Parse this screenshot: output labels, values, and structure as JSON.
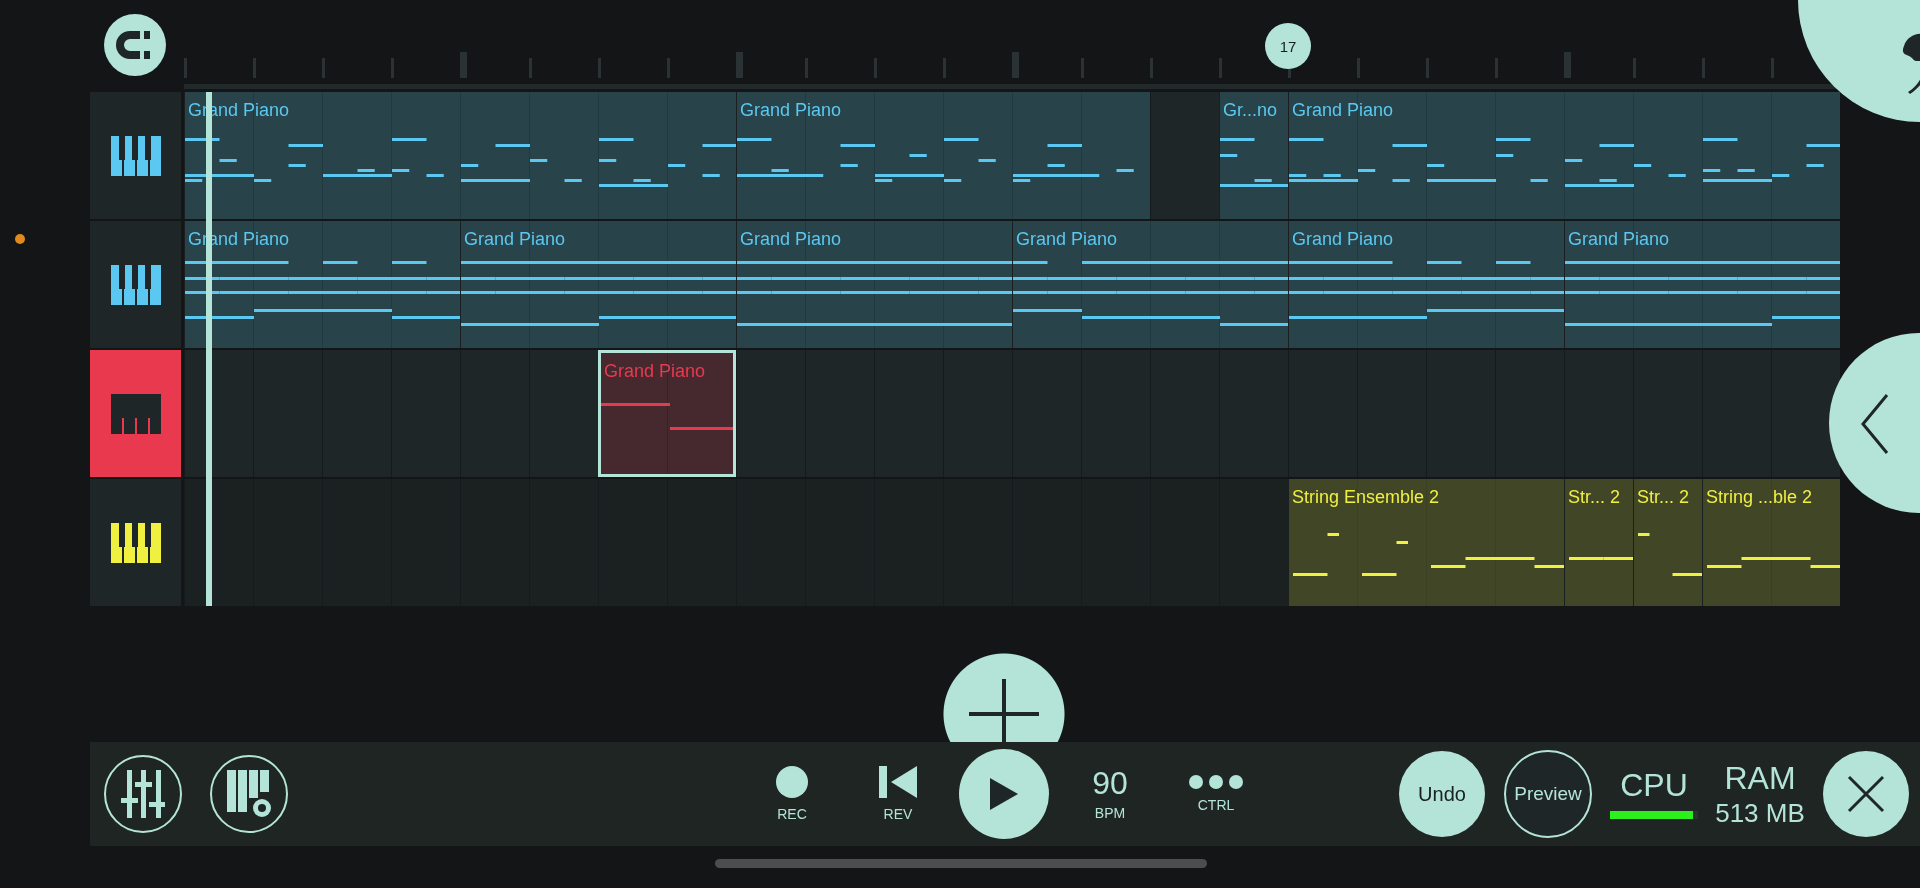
{
  "ruler": {
    "marker": "17"
  },
  "tracks": [
    {
      "color": "#5ac8f0",
      "selected": false,
      "clips": [
        {
          "label": "Grand Piano",
          "selected": false
        },
        {
          "label": "Grand Piano",
          "selected": false
        },
        {
          "label": "Gr...no",
          "selected": false
        },
        {
          "label": "Grand Piano",
          "selected": false
        }
      ]
    },
    {
      "color": "#5ac8f0",
      "selected": false,
      "clips": [
        {
          "label": "Grand Piano",
          "selected": false
        },
        {
          "label": "Grand Piano",
          "selected": false
        },
        {
          "label": "Grand Piano",
          "selected": false
        },
        {
          "label": "Grand Piano",
          "selected": false
        },
        {
          "label": "Grand Piano",
          "selected": false
        },
        {
          "label": "Grand Piano",
          "selected": false
        }
      ]
    },
    {
      "color": "#e8394f",
      "selected": true,
      "clips": [
        {
          "label": "Grand Piano",
          "selected": true
        }
      ]
    },
    {
      "color": "#f0f040",
      "selected": false,
      "clips": [
        {
          "label": "String Ensemble 2",
          "selected": false
        },
        {
          "label": "Str... 2",
          "selected": false
        },
        {
          "label": "Str... 2",
          "selected": false
        },
        {
          "label": "String ...ble 2",
          "selected": false
        }
      ]
    }
  ],
  "toolbar": {
    "transport": [
      {
        "kind": "record",
        "label": "REC"
      },
      {
        "kind": "rewind",
        "label": "REV"
      },
      {
        "kind": "play"
      },
      {
        "kind": "tempo",
        "value": "90",
        "label": "BPM"
      },
      {
        "kind": "more",
        "label": "CTRL"
      }
    ],
    "undo": "Undo",
    "preview": "Preview",
    "cpu": {
      "label": "CPU",
      "level": 0.94
    },
    "ram": {
      "label": "RAM",
      "value": "513 MB"
    }
  }
}
